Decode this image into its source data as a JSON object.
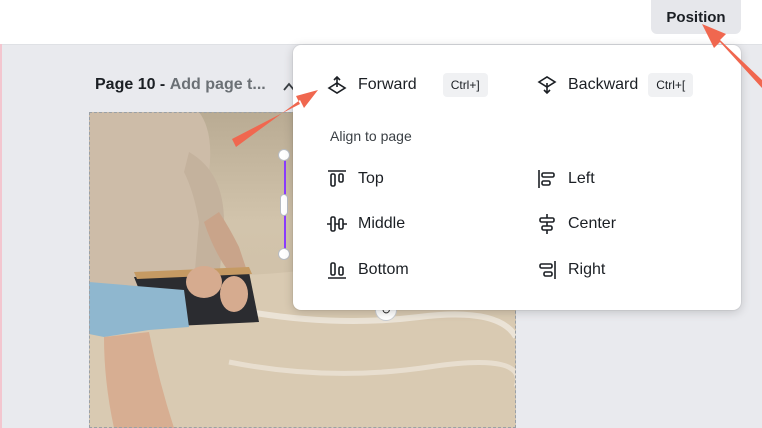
{
  "topbar": {
    "position_label": "Position"
  },
  "page": {
    "number_label": "Page 10 -",
    "title_placeholder": "Add page t..."
  },
  "menu": {
    "order": [
      {
        "label": "Forward",
        "shortcut": "Ctrl+]",
        "icon": "bring-forward-icon"
      },
      {
        "label": "Backward",
        "shortcut": "Ctrl+[",
        "icon": "send-backward-icon"
      }
    ],
    "align_title": "Align to page",
    "align_left_col": [
      {
        "label": "Top",
        "icon": "align-top-icon"
      },
      {
        "label": "Middle",
        "icon": "align-middle-icon"
      },
      {
        "label": "Bottom",
        "icon": "align-bottom-icon"
      }
    ],
    "align_right_col": [
      {
        "label": "Left",
        "icon": "align-left-icon"
      },
      {
        "label": "Center",
        "icon": "align-center-icon"
      },
      {
        "label": "Right",
        "icon": "align-right-icon"
      }
    ]
  },
  "colors": {
    "annotation_arrow": "#f0674f",
    "selection": "#8b3dff"
  }
}
